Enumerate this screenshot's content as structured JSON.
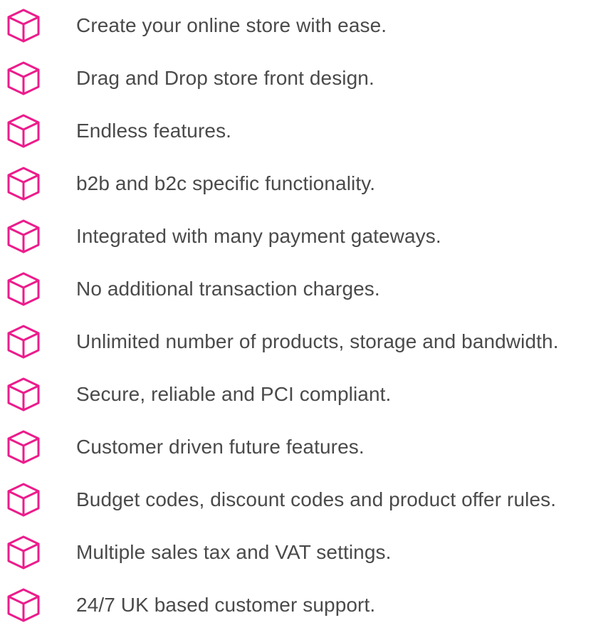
{
  "theme": {
    "icon_color": "#ec1c8c",
    "text_color": "#4a4a4a"
  },
  "features": [
    {
      "icon": "cube-icon",
      "text": "Create your online store with ease."
    },
    {
      "icon": "cube-icon",
      "text": "Drag and Drop store front design."
    },
    {
      "icon": "cube-icon",
      "text": "Endless features."
    },
    {
      "icon": "cube-icon",
      "text": "b2b and b2c specific functionality."
    },
    {
      "icon": "cube-icon",
      "text": "Integrated with many payment gateways."
    },
    {
      "icon": "cube-icon",
      "text": "No additional transaction charges."
    },
    {
      "icon": "cube-icon",
      "text": "Unlimited number of products, storage and bandwidth."
    },
    {
      "icon": "cube-icon",
      "text": "Secure, reliable and PCI compliant."
    },
    {
      "icon": "cube-icon",
      "text": "Customer driven future features."
    },
    {
      "icon": "cube-icon",
      "text": "Budget codes, discount codes and product offer rules."
    },
    {
      "icon": "cube-icon",
      "text": "Multiple sales tax and VAT settings."
    },
    {
      "icon": "cube-icon",
      "text": "24/7 UK based customer support."
    }
  ]
}
